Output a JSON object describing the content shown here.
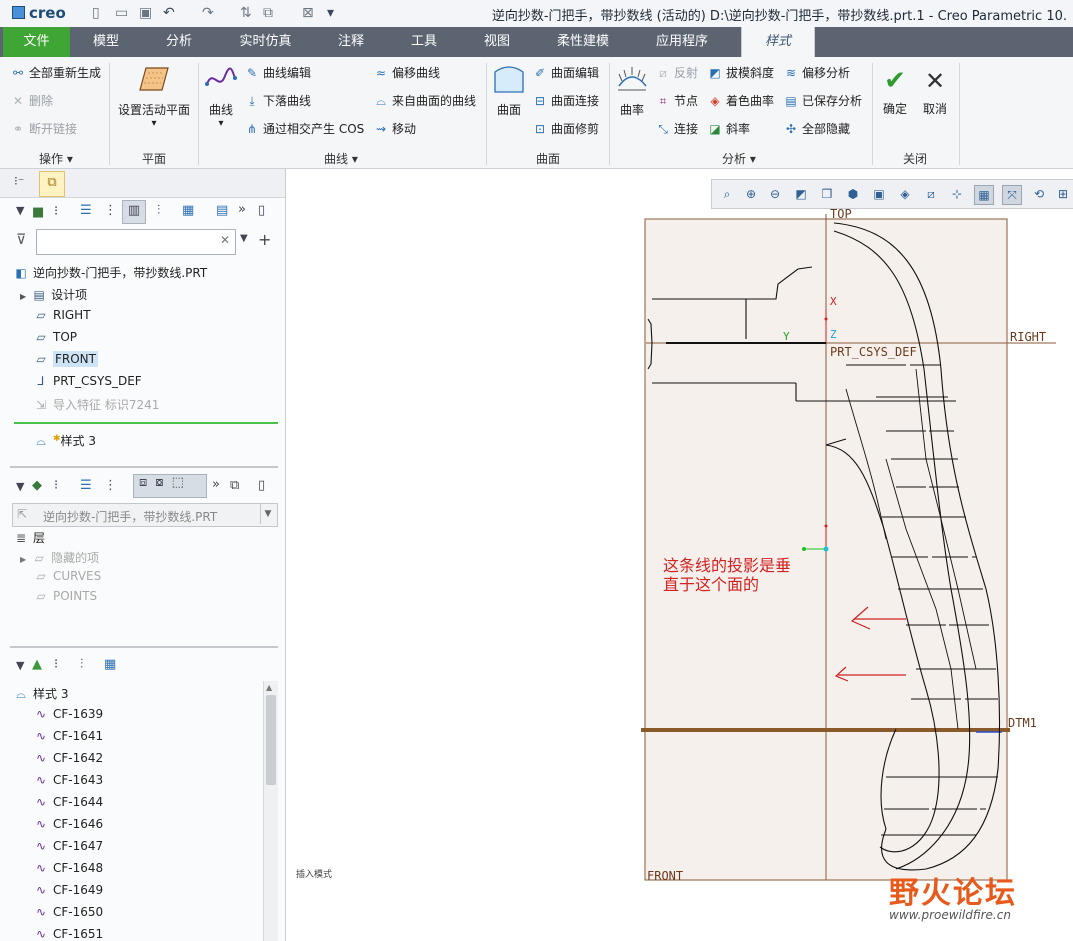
{
  "app": {
    "logo": "creo",
    "window_title": "逆向抄数-门把手，带抄数线 (活动的) D:\\逆向抄数-门把手，带抄数线.prt.1 - Creo Parametric 10."
  },
  "tabs": [
    "文件",
    "模型",
    "分析",
    "实时仿真",
    "注释",
    "工具",
    "视图",
    "柔性建模",
    "应用程序",
    "样式"
  ],
  "ribbon": {
    "operations": {
      "regen_all": "全部重新生成",
      "delete": "删除",
      "break_link": "断开链接",
      "group": "操作"
    },
    "plane": {
      "set_active": "设置活动平面",
      "group": "平面"
    },
    "curves": {
      "curve": "曲线",
      "edit_curve": "曲线编辑",
      "drop_curve": "下落曲线",
      "cos_intersect": "通过相交产生 COS",
      "offset_curve": "偏移曲线",
      "from_surface": "来自曲面的曲线",
      "move": "移动",
      "group": "曲线"
    },
    "surfaces": {
      "surface": "曲面",
      "edit": "曲面编辑",
      "connect": "曲面连接",
      "trim": "曲面修剪",
      "group": "曲面"
    },
    "analysis": {
      "curvature": "曲率",
      "reflect": "反射",
      "node": "节点",
      "connect": "连接",
      "draft": "拔模斜度",
      "shade_curv": "着色曲率",
      "slope": "斜率",
      "offset_analysis": "偏移分析",
      "saved_analysis": "已保存分析",
      "hide_all": "全部隐藏",
      "group": "分析"
    },
    "close": {
      "ok": "确定",
      "cancel": "取消",
      "group": "关闭"
    }
  },
  "model_tree": {
    "search_placeholder": "",
    "root": "逆向抄数-门把手，带抄数线.PRT",
    "items": [
      {
        "label": "设计项",
        "icon": "design-items-icon"
      },
      {
        "label": "RIGHT",
        "icon": "datum-plane-icon"
      },
      {
        "label": "TOP",
        "icon": "datum-plane-icon"
      },
      {
        "label": "FRONT",
        "icon": "datum-plane-icon"
      },
      {
        "label": "PRT_CSYS_DEF",
        "icon": "csys-icon"
      },
      {
        "label": "导入特征 标识7241",
        "icon": "import-feature-icon"
      }
    ],
    "style_feature": "样式 3"
  },
  "layer_tree": {
    "model_select": "逆向抄数-门把手，带抄数线.PRT",
    "root": "层",
    "items": [
      "隐藏的项",
      "CURVES",
      "POINTS"
    ]
  },
  "style_tree": {
    "root": "样式 3",
    "items": [
      "CF-1639",
      "CF-1641",
      "CF-1642",
      "CF-1643",
      "CF-1644",
      "CF-1646",
      "CF-1647",
      "CF-1648",
      "CF-1649",
      "CF-1650",
      "CF-1651"
    ]
  },
  "graphics": {
    "labels": {
      "top": "TOP",
      "right": "RIGHT",
      "front": "FRONT",
      "csys": "PRT_CSYS_DEF",
      "dtm": "DTM1",
      "x": "X",
      "y": "Y",
      "z": "Z"
    },
    "annotation": "这条线的投影是垂直于这个面的",
    "tiny_text": "插入模式",
    "watermark": "野火论坛",
    "watermark_url": "www.proewildfire.cn"
  }
}
